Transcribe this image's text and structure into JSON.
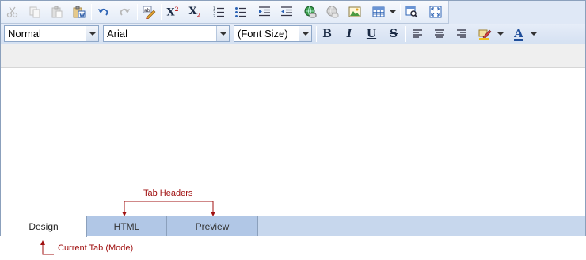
{
  "toolbar_row1": {
    "buttons": [
      "cut-icon",
      "copy-icon",
      "paste-icon",
      "paste-from-word-icon",
      "undo-icon",
      "redo-icon",
      "spellcheck-icon",
      "superscript-icon",
      "subscript-icon",
      "ordered-list-icon",
      "unordered-list-icon",
      "indent-icon",
      "outdent-icon",
      "insert-link-icon",
      "remove-link-icon",
      "insert-image-icon",
      "insert-table-icon",
      "find-icon",
      "fullscreen-icon"
    ],
    "superscript_label": "X",
    "superscript_mark": "2",
    "subscript_label": "X",
    "subscript_mark": "2"
  },
  "toolbar_row2": {
    "paragraph_style": "Normal",
    "font_name": "Arial",
    "font_size": "(Font Size)",
    "bold_label": "B",
    "italic_label": "I",
    "underline_label": "U",
    "strike_label": "S",
    "font_color_label": "A"
  },
  "colors": {
    "accent": "#1f4e9a",
    "callout": "#a01010",
    "tab_inactive": "#b1c7e6",
    "tabbar": "#c7d7ed"
  },
  "tabs": {
    "design": "Design",
    "html": "HTML",
    "preview": "Preview"
  },
  "annotations": {
    "tab_headers": "Tab Headers",
    "current_tab": "Current Tab (Mode)"
  }
}
